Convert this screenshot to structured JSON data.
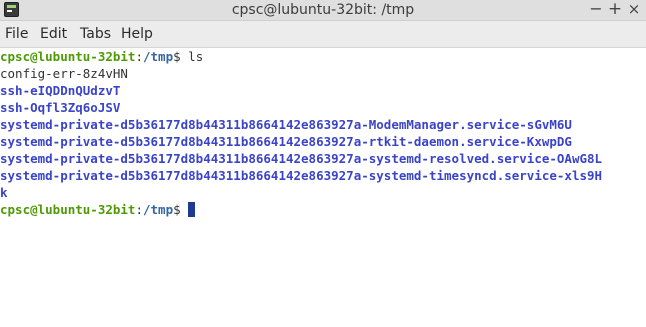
{
  "window": {
    "title": "cpsc@lubuntu-32bit: /tmp",
    "minimize_glyph": "−",
    "maximize_glyph": "+",
    "close_glyph": "×"
  },
  "menubar": {
    "file": "File",
    "edit": "Edit",
    "tabs": "Tabs",
    "help": "Help"
  },
  "terminal": {
    "prompt_user": "cpsc@lubuntu-32bit",
    "prompt_sep": ":",
    "prompt_path": "/tmp",
    "prompt_end": "$ ",
    "command": "ls",
    "entries": [
      "config-err-8z4vHN",
      "ssh-eIQDDnQUdzvT",
      "ssh-Oqfl3Zq6oJSV",
      "systemd-private-d5b36177d8b44311b8664142e863927a-ModemManager.service-sGvM6U",
      "systemd-private-d5b36177d8b44311b8664142e863927a-rtkit-daemon.service-KxwpDG",
      "systemd-private-d5b36177d8b44311b8664142e863927a-systemd-resolved.service-OAwG8L",
      "systemd-private-d5b36177d8b44311b8664142e863927a-systemd-timesyncd.service-xls9H",
      "k"
    ]
  },
  "colors": {
    "prompt_user": "#4e9a06",
    "prompt_path": "#3465a4",
    "directory": "#3a44c8",
    "plain_text": "#333333",
    "cursor": "#1f3a93"
  },
  "icons": {
    "app": "terminal-icon",
    "minimize": "minimize-icon",
    "maximize": "maximize-icon",
    "close": "close-icon"
  }
}
